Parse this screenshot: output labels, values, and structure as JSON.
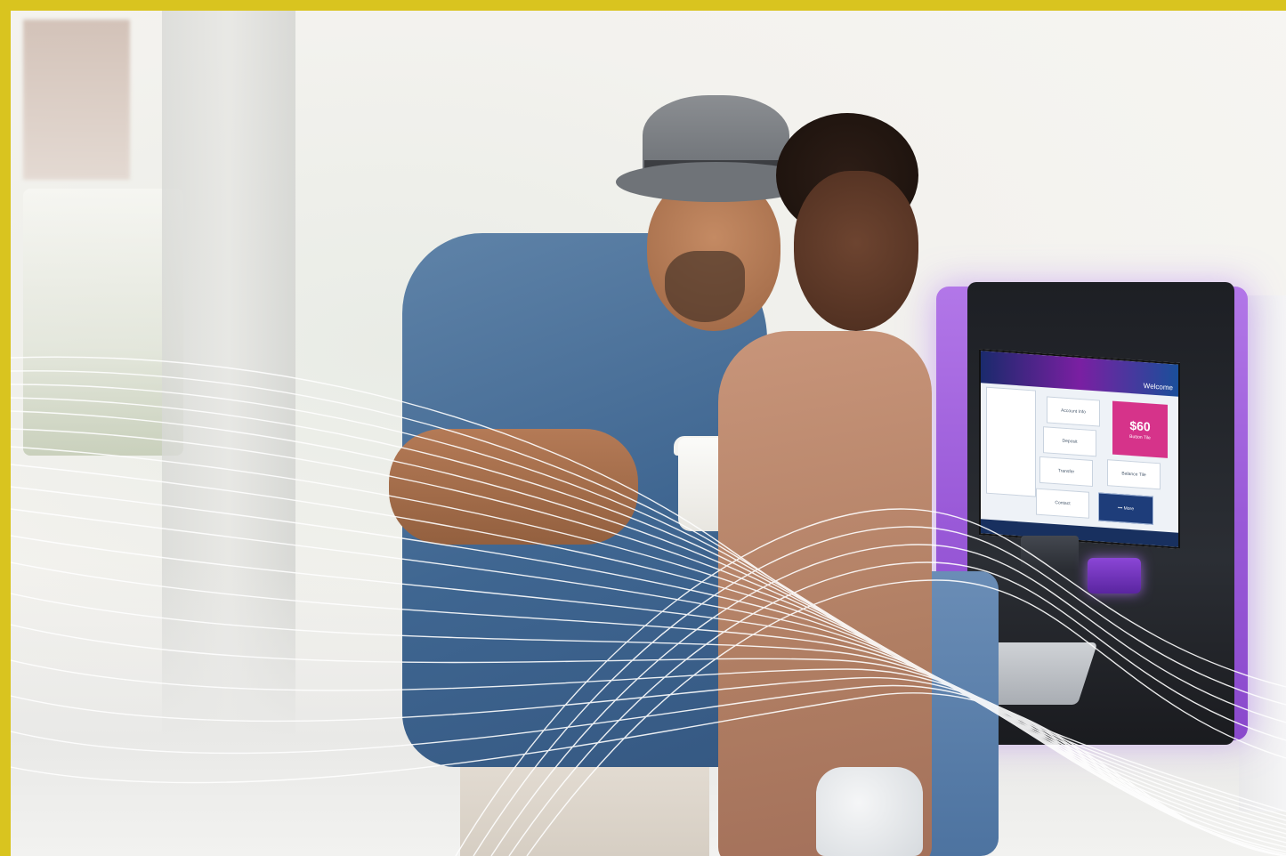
{
  "atm_screen": {
    "welcome_label": "Welcome",
    "tiles": [
      "Account Info",
      "Deposit",
      "Transfer",
      "Balance Tile",
      "Contact"
    ],
    "highlight_price": "$60",
    "highlight_caption": "Button Tile",
    "more_label": "••• More"
  },
  "colors": {
    "frame": "#d9c41f",
    "kiosk_glow": "#9a5ad8",
    "highlight_tile": "#d6338a"
  }
}
